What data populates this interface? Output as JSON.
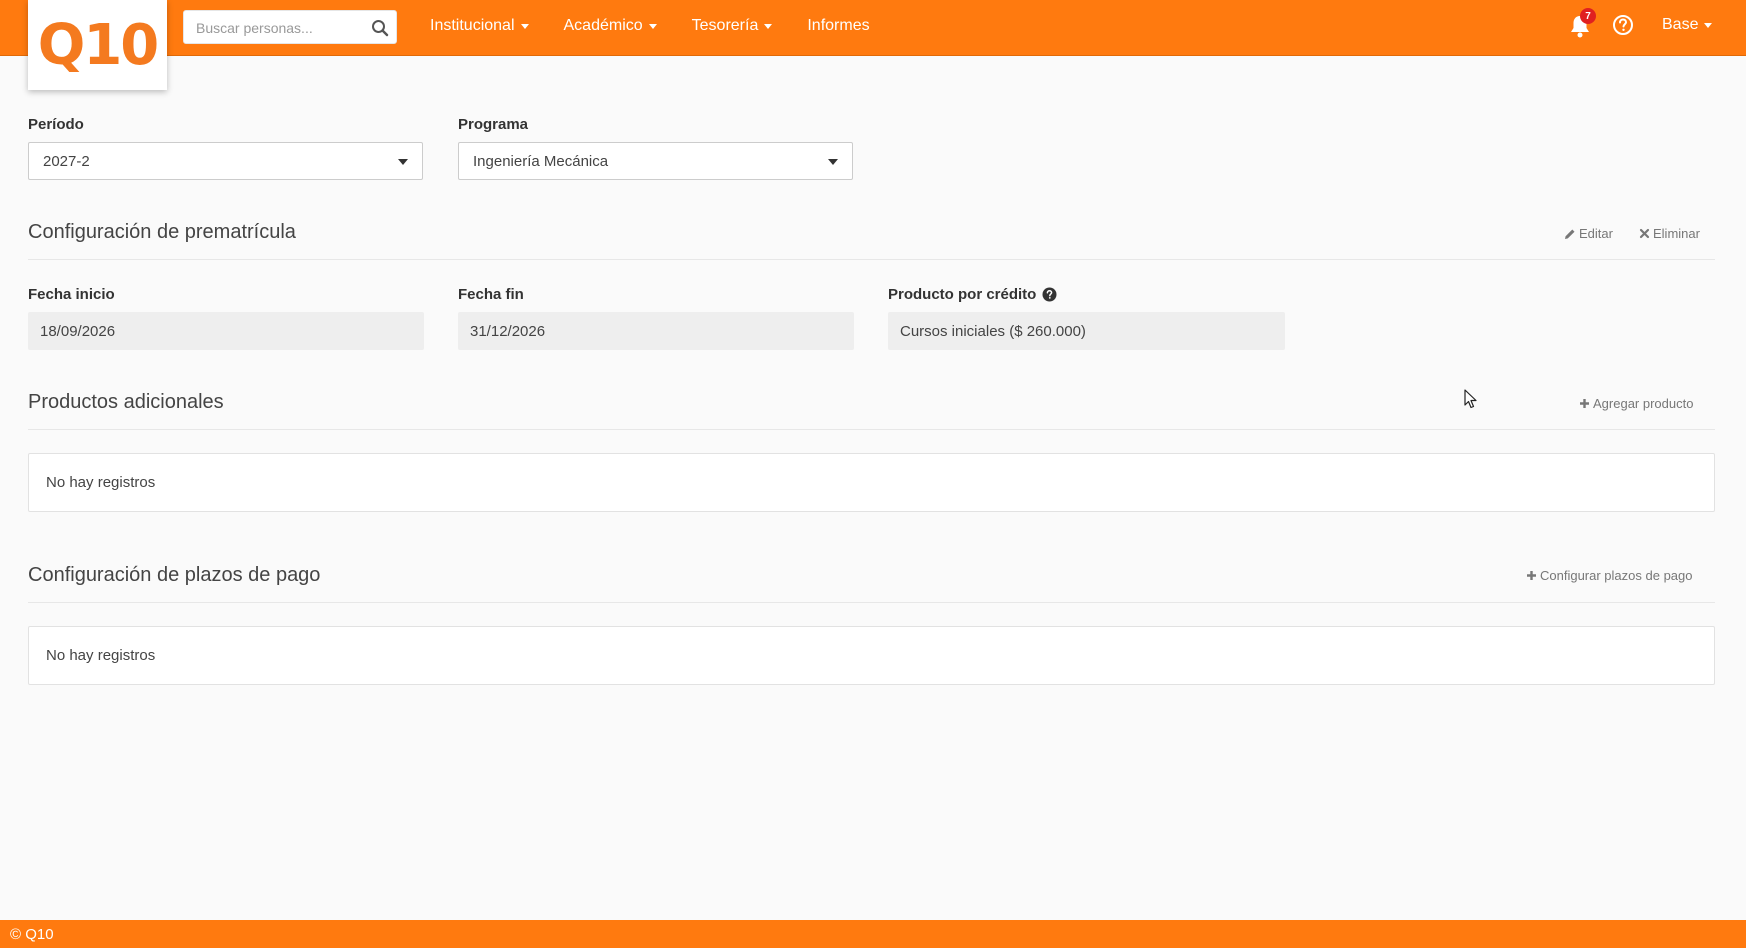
{
  "header": {
    "logo_text": "Q10",
    "search": {
      "placeholder": "Buscar personas..."
    },
    "nav": [
      {
        "label": "Institucional",
        "has_dropdown": true
      },
      {
        "label": "Académico",
        "has_dropdown": true
      },
      {
        "label": "Tesorería",
        "has_dropdown": true
      },
      {
        "label": "Informes",
        "has_dropdown": false
      }
    ],
    "notifications_count": "7",
    "user_menu_label": "Base"
  },
  "filters": {
    "periodo": {
      "label": "Período",
      "value": "2027-2"
    },
    "programa": {
      "label": "Programa",
      "value": "Ingeniería Mecánica"
    }
  },
  "prematricula": {
    "title": "Configuración de prematrícula",
    "edit_label": "Editar",
    "delete_label": "Eliminar",
    "fecha_inicio": {
      "label": "Fecha inicio",
      "value": "18/09/2026"
    },
    "fecha_fin": {
      "label": "Fecha fin",
      "value": "31/12/2026"
    },
    "producto_credito": {
      "label": "Producto por crédito",
      "value": "Cursos iniciales ($ 260.000)"
    }
  },
  "productos_adicionales": {
    "title": "Productos adicionales",
    "add_label": "Agregar producto",
    "empty_text": "No hay registros"
  },
  "plazos_pago": {
    "title": "Configuración de plazos de pago",
    "config_label": "Configurar plazos de pago",
    "empty_text": "No hay registros"
  },
  "footer": {
    "text": "© Q10"
  },
  "colors": {
    "brand": "#ff7a0f",
    "logo": "#f47a1f",
    "badge": "#e02020"
  }
}
